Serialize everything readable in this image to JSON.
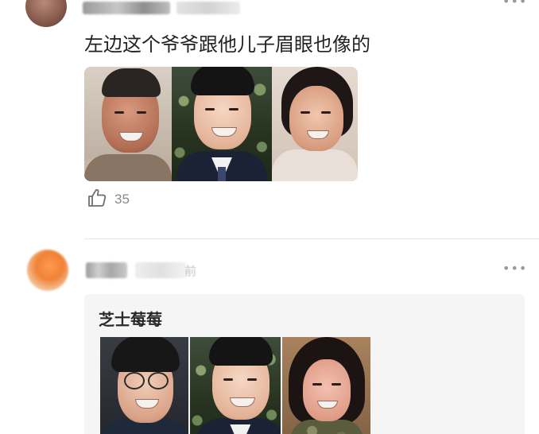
{
  "comments": [
    {
      "text": "左边这个爷爷跟他儿子眉眼也像的",
      "photos": [
        "older-man-photo",
        "young-man-photo",
        "woman-photo"
      ],
      "like_icon": "thumbs-up-icon",
      "likes": "35",
      "more_icon": "more-dots-icon",
      "more_label": "•••"
    },
    {
      "time_suffix": "前",
      "quote_title": "芝士莓莓",
      "photos": [
        "glasses-man-photo",
        "young-man-photo",
        "woman-photo"
      ],
      "more_icon": "more-dots-icon",
      "more_label": "•••"
    }
  ],
  "colors": {
    "text": "#222222",
    "muted": "#8a8a8a",
    "divider": "#e6e6e6",
    "quote_bg": "#f5f5f5"
  }
}
